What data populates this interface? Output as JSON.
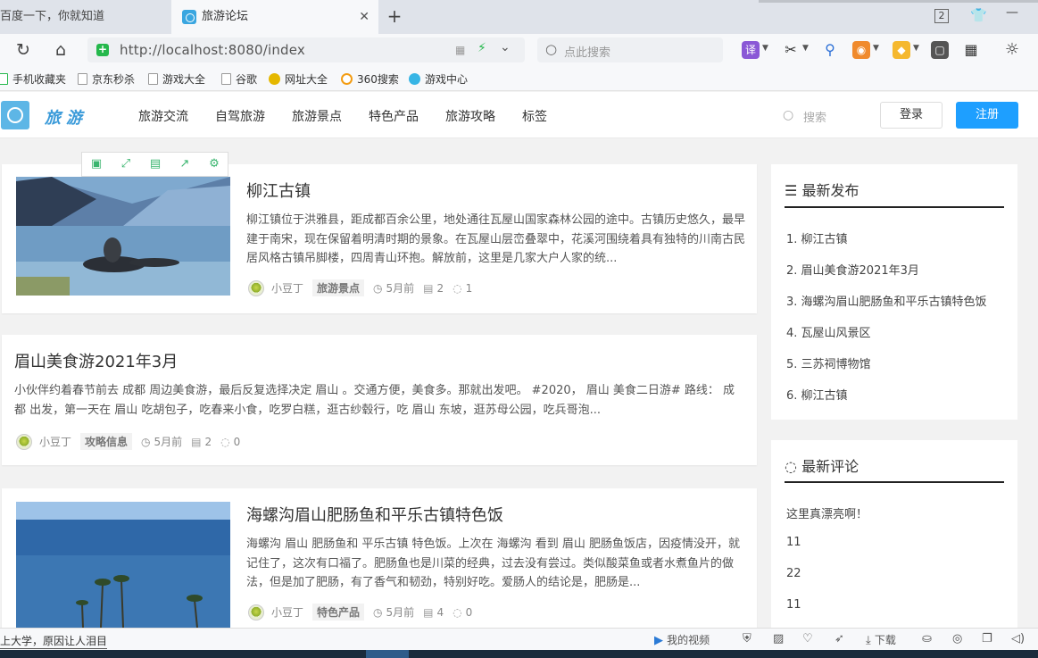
{
  "browser": {
    "tabs": [
      {
        "label": "百度一下，你就知道",
        "active": false
      },
      {
        "label": "旅游论坛",
        "active": true
      }
    ],
    "window_count": "2",
    "url": "http://localhost:8080/index",
    "search_placeholder": "点此搜索",
    "translate_icon_label": "译",
    "bookmarks": [
      "手机收藏夹",
      "京东秒杀",
      "游戏大全",
      "谷歌",
      "网址大全",
      "360搜索",
      "游戏中心"
    ],
    "status_left": "上大学，原因让人泪目",
    "status_video": "我的视频",
    "status_download": "下载"
  },
  "site": {
    "logo_text": "旅游",
    "nav": [
      "旅游交流",
      "自驾旅游",
      "旅游景点",
      "特色产品",
      "旅游攻略",
      "标签"
    ],
    "search_placeholder": "搜索",
    "login": "登录",
    "register": "注册"
  },
  "posts": [
    {
      "title": "柳江古镇",
      "excerpt": "柳江镇位于洪雅县，距成都百余公里，地处通往瓦屋山国家森林公园的途中。古镇历史悠久，最早建于南宋，现在保留着明清时期的景象。在瓦屋山层峦叠翠中，花溪河围绕着具有独特的川南古民居风格古镇吊脚楼，四周青山环抱。解放前，这里是几家大户人家的统...",
      "author": "小豆丁",
      "category": "旅游景点",
      "time": "5月前",
      "views": "2",
      "comments": "1"
    },
    {
      "title": "眉山美食游2021年3月",
      "excerpt": "小伙伴约着春节前去 成都 周边美食游，最后反复选择决定 眉山 。交通方便，美食多。那就出发吧。 #2020， 眉山 美食二日游# 路线： 成都 出发，第一天在 眉山 吃胡包子，吃春来小食，吃罗白糕，逛古纱毂行，吃 眉山 东坡，逛苏母公园，吃兵哥泡...",
      "author": "小豆丁",
      "category": "攻略信息",
      "time": "5月前",
      "views": "2",
      "comments": "0"
    },
    {
      "title": "海螺沟眉山肥肠鱼和平乐古镇特色饭",
      "excerpt": "海螺沟 眉山 肥肠鱼和 平乐古镇 特色饭。上次在 海螺沟 看到 眉山 肥肠鱼饭店，因疫情没开，就记住了，这次有口福了。肥肠鱼也是川菜的经典，过去没有尝过。类似酸菜鱼或者水煮鱼片的做法，但是加了肥肠，有了香气和韧劲，特别好吃。爱肠人的结论是，肥肠是...",
      "author": "小豆丁",
      "category": "特色产品",
      "time": "5月前",
      "views": "4",
      "comments": "0"
    }
  ],
  "sidebar": {
    "latest_title": "最新发布",
    "latest": [
      "1. 柳江古镇",
      "2. 眉山美食游2021年3月",
      "3. 海螺沟眉山肥肠鱼和平乐古镇特色饭",
      "4. 瓦屋山风景区",
      "5. 三苏祠博物馆",
      "6. 柳江古镇"
    ],
    "comments_title": "最新评论",
    "comments": [
      "这里真漂亮啊！",
      "11",
      "22",
      "11"
    ]
  },
  "colors": {
    "accent": "#1e9fff",
    "logo": "#3a9ad9",
    "secure": "#25b84c"
  }
}
